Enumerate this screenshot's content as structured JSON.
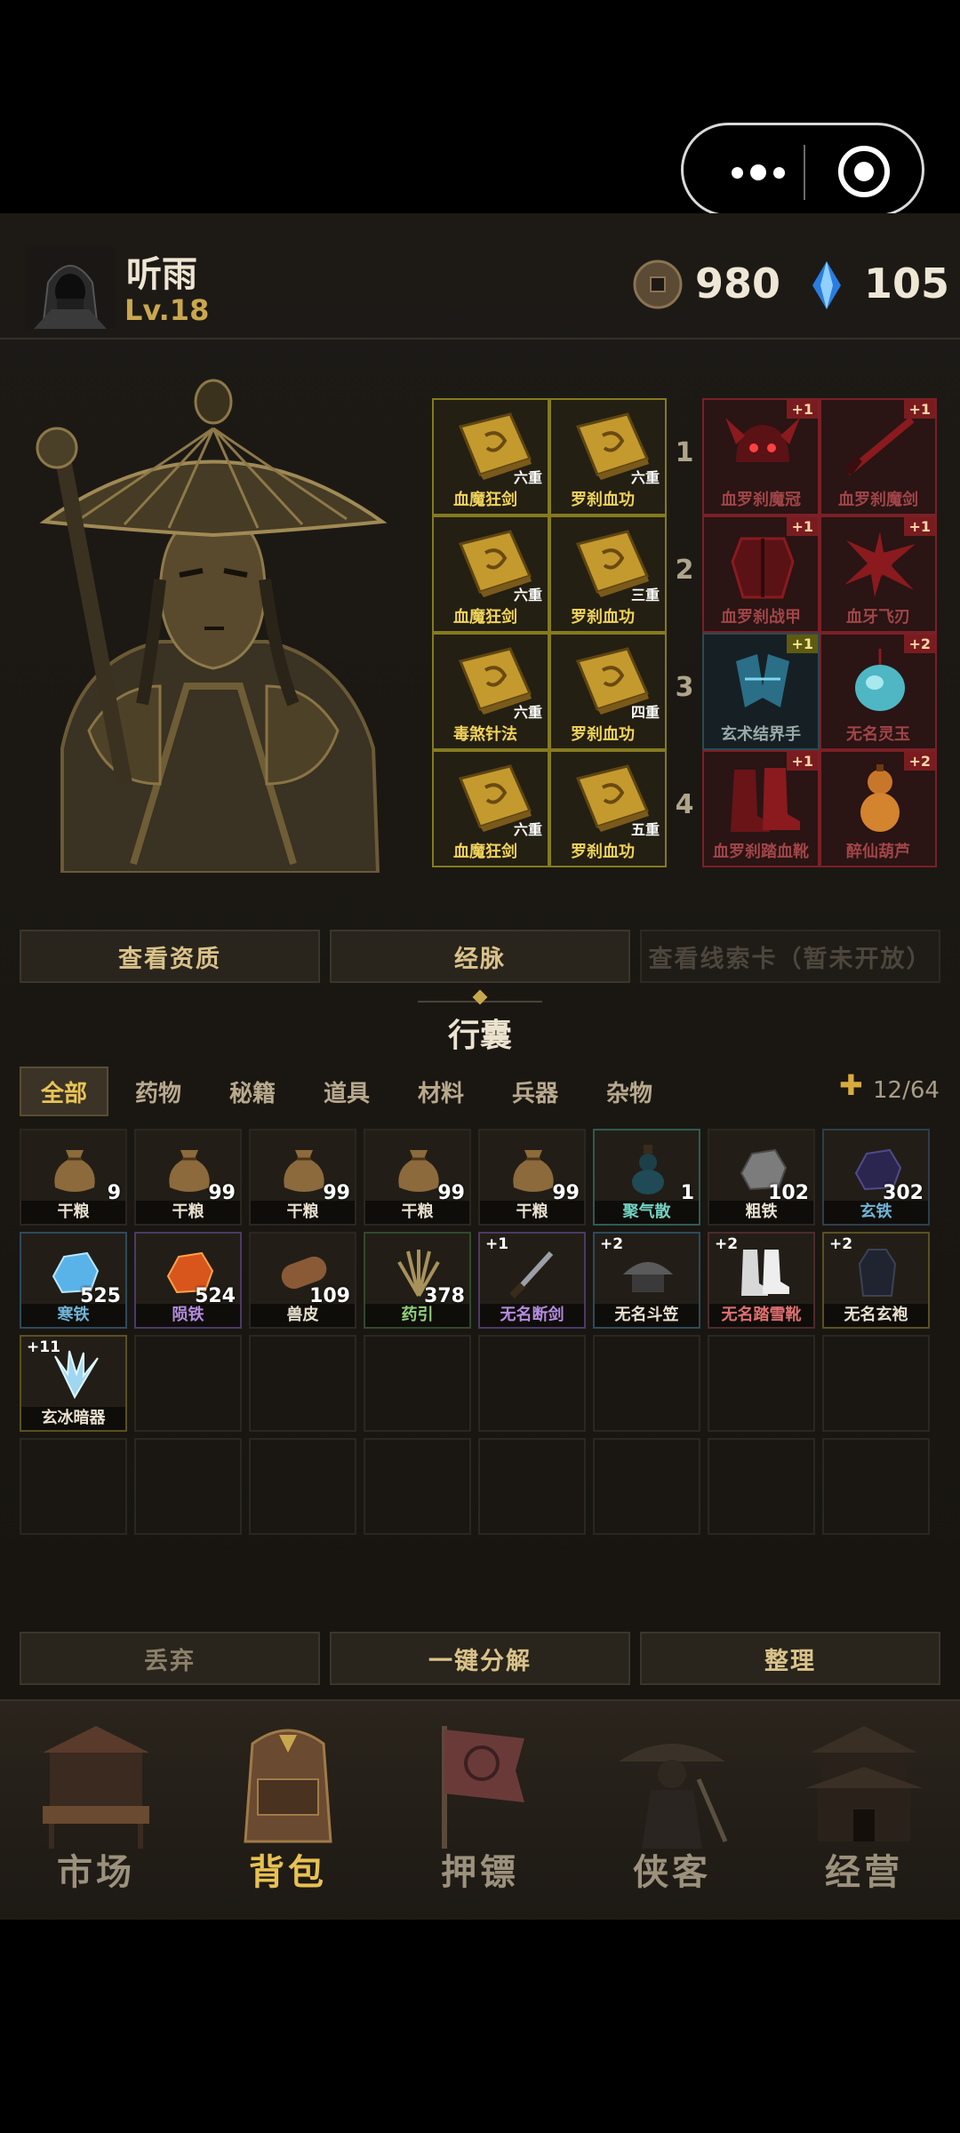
{
  "player": {
    "name": "听雨",
    "level": "Lv.18",
    "coins": "980",
    "gems": "105"
  },
  "equipment": {
    "rows": [
      {
        "num": "1",
        "book1": {
          "name": "血魔狂剑",
          "tier": "六重"
        },
        "book2": {
          "name": "罗刹血功",
          "tier": "六重"
        },
        "gear1": {
          "name": "血罗刹魔冠",
          "plus": "+1"
        },
        "gear2": {
          "name": "血罗刹魔剑",
          "plus": "+1"
        }
      },
      {
        "num": "2",
        "book1": {
          "name": "血魔狂剑",
          "tier": "六重"
        },
        "book2": {
          "name": "罗刹血功",
          "tier": "三重"
        },
        "gear1": {
          "name": "血罗刹战甲",
          "plus": "+1"
        },
        "gear2": {
          "name": "血牙飞刃",
          "plus": "+1"
        }
      },
      {
        "num": "3",
        "book1": {
          "name": "毒煞针法",
          "tier": "六重"
        },
        "book2": {
          "name": "罗刹血功",
          "tier": "四重"
        },
        "gear1": {
          "name": "玄术结界手",
          "plus": "+1"
        },
        "gear2": {
          "name": "无名灵玉",
          "plus": "+2"
        }
      },
      {
        "num": "4",
        "book1": {
          "name": "血魔狂剑",
          "tier": "六重"
        },
        "book2": {
          "name": "罗刹血功",
          "tier": "五重"
        },
        "gear1": {
          "name": "血罗刹踏血靴",
          "plus": "+1"
        },
        "gear2": {
          "name": "醉仙葫芦",
          "plus": "+2"
        }
      }
    ]
  },
  "actions": {
    "aptitude": "查看资质",
    "meridian": "经脉",
    "clue": "查看线索卡（暂未开放）"
  },
  "bag": {
    "title": "行囊",
    "tabs": [
      "全部",
      "药物",
      "秘籍",
      "道具",
      "材料",
      "兵器",
      "杂物"
    ],
    "capacity_plus": "✚",
    "capacity": "12/64",
    "items": [
      {
        "name": "干粮",
        "count": "9",
        "icon": "grain-sack-icon"
      },
      {
        "name": "干粮",
        "count": "99",
        "icon": "grain-sack-icon"
      },
      {
        "name": "干粮",
        "count": "99",
        "icon": "grain-sack-icon"
      },
      {
        "name": "干粮",
        "count": "99",
        "icon": "grain-sack-icon"
      },
      {
        "name": "干粮",
        "count": "99",
        "icon": "grain-sack-icon"
      },
      {
        "name": "聚气散",
        "count": "1",
        "icon": "gourd-bottle-icon"
      },
      {
        "name": "粗铁",
        "count": "102",
        "icon": "iron-ore-icon"
      },
      {
        "name": "玄铁",
        "count": "302",
        "icon": "dark-ore-icon"
      },
      {
        "name": "寒铁",
        "count": "525",
        "icon": "ice-ore-icon"
      },
      {
        "name": "陨铁",
        "count": "524",
        "icon": "meteor-ore-icon"
      },
      {
        "name": "兽皮",
        "count": "109",
        "icon": "hide-roll-icon"
      },
      {
        "name": "药引",
        "count": "378",
        "icon": "herb-bundle-icon"
      },
      {
        "name": "无名断剑",
        "enh": "+1",
        "icon": "broken-sword-icon"
      },
      {
        "name": "无名斗笠",
        "enh": "+2",
        "icon": "straw-hat-icon"
      },
      {
        "name": "无名踏雪靴",
        "enh": "+2",
        "icon": "boots-icon"
      },
      {
        "name": "无名玄袍",
        "enh": "+2",
        "icon": "robe-icon"
      },
      {
        "name": "玄冰暗器",
        "enh": "+11",
        "icon": "ice-shards-icon"
      }
    ]
  },
  "bottom_actions": {
    "discard": "丢弃",
    "decompose": "一键分解",
    "sort": "整理"
  },
  "nav": [
    {
      "label": "市场",
      "icon": "market-stall-icon"
    },
    {
      "label": "背包",
      "icon": "backpack-icon"
    },
    {
      "label": "押镖",
      "icon": "escort-flag-icon"
    },
    {
      "label": "侠客",
      "icon": "swordsman-icon"
    },
    {
      "label": "经营",
      "icon": "pavilion-icon"
    }
  ],
  "colors": {
    "accent": "#e9c356",
    "book_border": "#857a1f",
    "gear_border": "#7a2026"
  }
}
